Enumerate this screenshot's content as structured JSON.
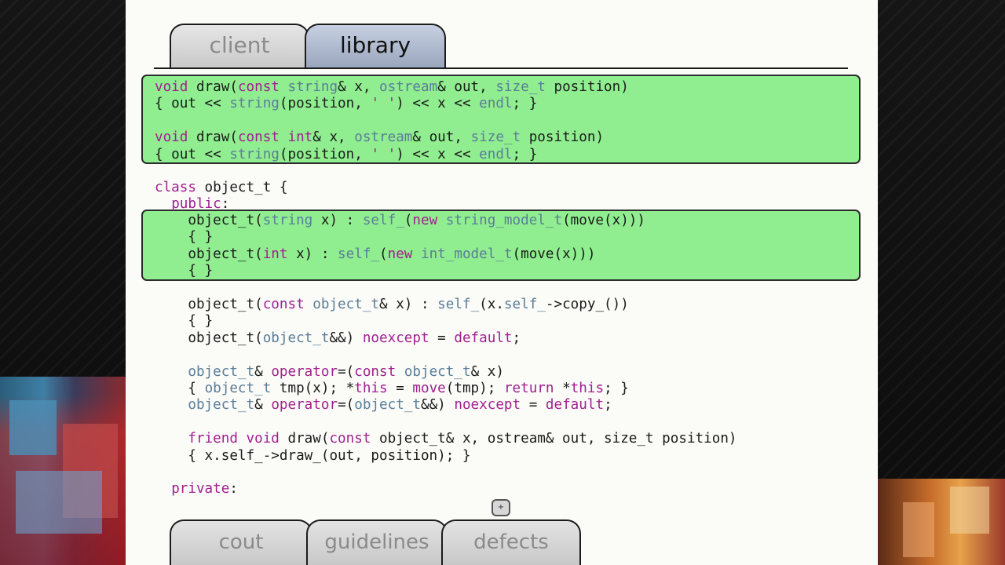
{
  "tabs": {
    "top": [
      {
        "label": "client",
        "active": false
      },
      {
        "label": "library",
        "active": true
      }
    ],
    "bottom": [
      {
        "label": "cout"
      },
      {
        "label": "guidelines"
      },
      {
        "label": "defects"
      }
    ]
  },
  "code": {
    "box1": [
      [
        [
          "void",
          "kw"
        ],
        [
          " draw(",
          "txt"
        ],
        [
          "const",
          "kw"
        ],
        [
          " ",
          "txt"
        ],
        [
          "string",
          "ty"
        ],
        [
          "& x, ",
          "txt"
        ],
        [
          "ostream",
          "ty"
        ],
        [
          "& out, ",
          "txt"
        ],
        [
          "size_t",
          "ty"
        ],
        [
          " position)",
          "txt"
        ]
      ],
      [
        [
          "{ out << ",
          "txt"
        ],
        [
          "string",
          "ty"
        ],
        [
          "(position, ",
          "txt"
        ],
        [
          "' '",
          "kw"
        ],
        [
          ") << x << ",
          "txt"
        ],
        [
          "endl",
          "ty"
        ],
        [
          "; }",
          "txt"
        ]
      ],
      [
        [
          "",
          "txt"
        ]
      ],
      [
        [
          "void",
          "kw"
        ],
        [
          " draw(",
          "txt"
        ],
        [
          "const",
          "kw"
        ],
        [
          " ",
          "txt"
        ],
        [
          "int",
          "kw"
        ],
        [
          "& x, ",
          "txt"
        ],
        [
          "ostream",
          "ty"
        ],
        [
          "& out, ",
          "txt"
        ],
        [
          "size_t",
          "ty"
        ],
        [
          " position)",
          "txt"
        ]
      ],
      [
        [
          "{ out << ",
          "txt"
        ],
        [
          "string",
          "ty"
        ],
        [
          "(position, ",
          "txt"
        ],
        [
          "' '",
          "kw"
        ],
        [
          ") << x << ",
          "txt"
        ],
        [
          "endl",
          "ty"
        ],
        [
          "; }",
          "txt"
        ]
      ]
    ],
    "mid": [
      [
        [
          "class",
          "kw"
        ],
        [
          " object_t {",
          "txt"
        ]
      ],
      [
        [
          "  ",
          "txt"
        ],
        [
          "public",
          "kw"
        ],
        [
          ":",
          "txt"
        ]
      ]
    ],
    "box2": [
      [
        [
          "    object_t(",
          "txt"
        ],
        [
          "string",
          "ty"
        ],
        [
          " x) : ",
          "txt"
        ],
        [
          "self_",
          "sf"
        ],
        [
          "(",
          "txt"
        ],
        [
          "new",
          "kw"
        ],
        [
          " ",
          "txt"
        ],
        [
          "string_model_t",
          "ty"
        ],
        [
          "(move(x)))",
          "txt"
        ]
      ],
      [
        [
          "    { }",
          "txt"
        ]
      ],
      [
        [
          "    object_t(",
          "txt"
        ],
        [
          "int",
          "kw"
        ],
        [
          " x) : ",
          "txt"
        ],
        [
          "self_",
          "sf"
        ],
        [
          "(",
          "txt"
        ],
        [
          "new",
          "kw"
        ],
        [
          " ",
          "txt"
        ],
        [
          "int_model_t",
          "ty"
        ],
        [
          "(move(x)))",
          "txt"
        ]
      ],
      [
        [
          "    { }",
          "txt"
        ]
      ]
    ],
    "rest": [
      [
        [
          "    object_t(",
          "txt"
        ],
        [
          "const",
          "kw"
        ],
        [
          " ",
          "txt"
        ],
        [
          "object_t",
          "ty"
        ],
        [
          "& x) : ",
          "txt"
        ],
        [
          "self_",
          "sf"
        ],
        [
          "(x.",
          "txt"
        ],
        [
          "self_",
          "sf"
        ],
        [
          "->copy_())",
          "txt"
        ]
      ],
      [
        [
          "    { }",
          "txt"
        ]
      ],
      [
        [
          "    object_t(",
          "txt"
        ],
        [
          "object_t",
          "ty"
        ],
        [
          "&&) ",
          "txt"
        ],
        [
          "noexcept",
          "kw"
        ],
        [
          " = ",
          "txt"
        ],
        [
          "default",
          "kw"
        ],
        [
          ";",
          "txt"
        ]
      ],
      [
        [
          "",
          "txt"
        ]
      ],
      [
        [
          "    ",
          "txt"
        ],
        [
          "object_t",
          "ty"
        ],
        [
          "& ",
          "txt"
        ],
        [
          "operator",
          "kw"
        ],
        [
          "=(",
          "txt"
        ],
        [
          "const",
          "kw"
        ],
        [
          " ",
          "txt"
        ],
        [
          "object_t",
          "ty"
        ],
        [
          "& x)",
          "txt"
        ]
      ],
      [
        [
          "    { ",
          "txt"
        ],
        [
          "object_t",
          "ty"
        ],
        [
          " tmp(x); *",
          "txt"
        ],
        [
          "this",
          "kw"
        ],
        [
          " = ",
          "txt"
        ],
        [
          "move",
          "kw"
        ],
        [
          "(tmp); ",
          "txt"
        ],
        [
          "return",
          "kw"
        ],
        [
          " *",
          "txt"
        ],
        [
          "this",
          "kw"
        ],
        [
          "; }",
          "txt"
        ]
      ],
      [
        [
          "    ",
          "txt"
        ],
        [
          "object_t",
          "ty"
        ],
        [
          "& ",
          "txt"
        ],
        [
          "operator",
          "kw"
        ],
        [
          "=(",
          "txt"
        ],
        [
          "object_t",
          "ty"
        ],
        [
          "&&) ",
          "txt"
        ],
        [
          "noexcept",
          "kw"
        ],
        [
          " = ",
          "txt"
        ],
        [
          "default",
          "kw"
        ],
        [
          ";",
          "txt"
        ]
      ],
      [
        [
          "",
          "txt"
        ]
      ],
      [
        [
          "    ",
          "txt"
        ],
        [
          "friend",
          "kw"
        ],
        [
          " ",
          "txt"
        ],
        [
          "void",
          "kw"
        ],
        [
          " draw(",
          "txt"
        ],
        [
          "const",
          "kw"
        ],
        [
          " object_t& x, ostream& out, size_t position)",
          "txt"
        ]
      ],
      [
        [
          "    { x.self_->draw_(out, position); }",
          "txt"
        ]
      ],
      [
        [
          "",
          "txt"
        ]
      ],
      [
        [
          "  ",
          "txt"
        ],
        [
          "private",
          "kw"
        ],
        [
          ":",
          "txt"
        ]
      ]
    ]
  },
  "control": {
    "glyph": "+"
  }
}
